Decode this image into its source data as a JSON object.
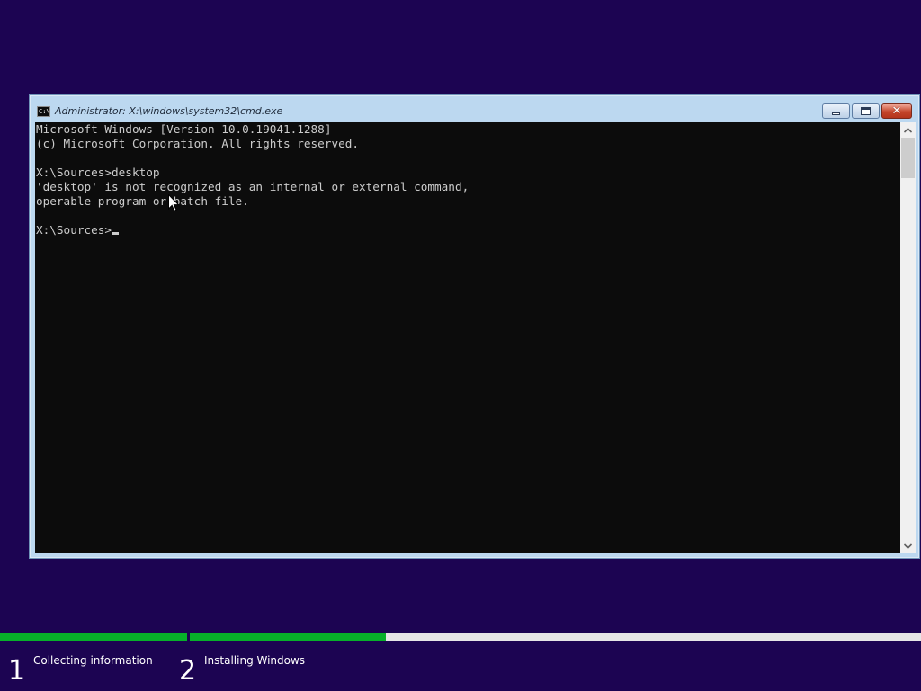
{
  "window": {
    "title": "Administrator: X:\\windows\\system32\\cmd.exe",
    "icon_text": "C:\\",
    "icon": "cmd-icon"
  },
  "console": {
    "lines": [
      "Microsoft Windows [Version 10.0.19041.1288]",
      "(c) Microsoft Corporation. All rights reserved.",
      "",
      "X:\\Sources>desktop",
      "'desktop' is not recognized as an internal or external command,",
      "operable program or batch file.",
      ""
    ],
    "prompt": "X:\\Sources>",
    "text_color": "#cccccc",
    "background": "#0c0c0c"
  },
  "setup": {
    "steps": [
      {
        "number": "1",
        "label": "Collecting information",
        "progress": 1.0
      },
      {
        "number": "2",
        "label": "Installing Windows",
        "progress": 0.268
      }
    ],
    "progress_color": "#07b02a",
    "background": "#1c0452"
  }
}
